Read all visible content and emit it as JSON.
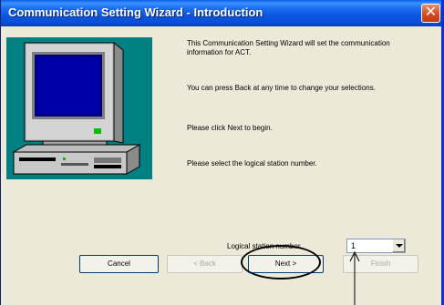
{
  "window": {
    "title": "Communication Setting Wizard - Introduction",
    "close_glyph": "✕"
  },
  "intro": {
    "line1": "This Communication Setting Wizard will set the communication information for ACT.",
    "line2": "You can press Back at any time to change your selections.",
    "line3": "Please click Next to begin.",
    "line4": "Please select the logical station number."
  },
  "station": {
    "label": "Logical station number",
    "value": "1"
  },
  "buttons": {
    "cancel": "Cancel",
    "back": "< Back",
    "next": "Next >",
    "finish": "Finish"
  },
  "colors": {
    "title_bar": "#0b55e0",
    "panel": "#008080",
    "dialog_bg": "#ece9d8"
  },
  "icons": {
    "picture": "computer-monitor-icon"
  }
}
